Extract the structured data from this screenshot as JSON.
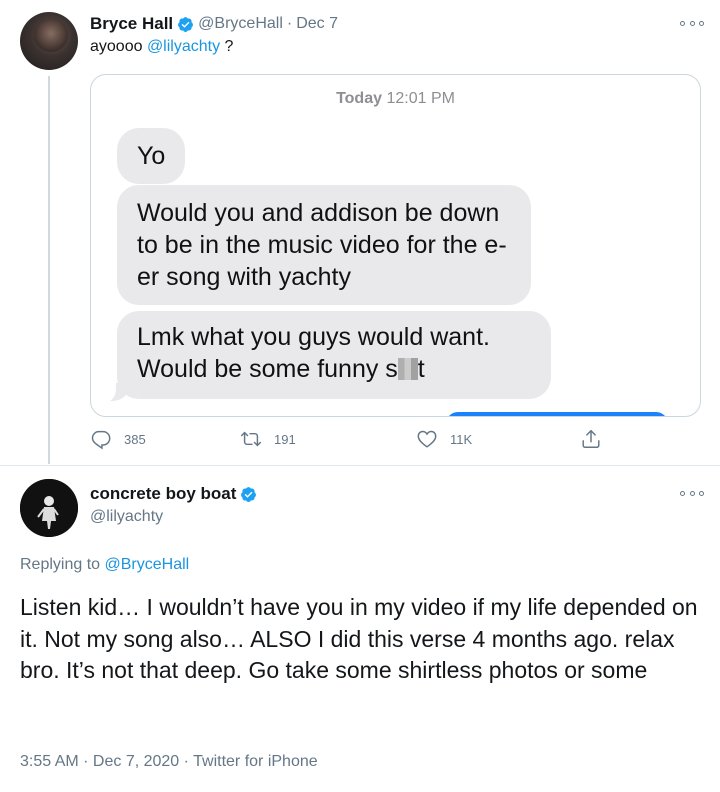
{
  "tweet": {
    "author": {
      "display_name": "Bryce Hall",
      "handle": "@BryceHall",
      "date_sep": "·",
      "date": "Dec 7"
    },
    "text_prefix": "ayoooo ",
    "mention": "@lilyachty",
    "text_suffix": " ?",
    "screenshot": {
      "time_day": "Today",
      "time_clock": "12:01 PM",
      "messages": [
        "Yo",
        "Would you and addison be down to be in the music video for the e-er song with yachty",
        "Lmk what you guys would want. Would be some funny s",
        "t"
      ]
    },
    "actions": {
      "replies": "385",
      "retweets": "191",
      "likes": "11K"
    }
  },
  "reply": {
    "author": {
      "display_name": "concrete boy boat",
      "handle": "@lilyachty"
    },
    "replying_prefix": "Replying to ",
    "replying_to": "@BryceHall",
    "text": "Listen kid… I wouldn’t have you in my video if my life depended on it. Not my song also… ALSO I did this verse 4 months ago. relax bro. It’s not that deep. Go take some shirtless photos or some",
    "timestamp": "3:55 AM · Dec 7, 2020 · Twitter for iPhone"
  },
  "colors": {
    "accent": "#1b95e0",
    "verified": "#1da1f2",
    "secondary_text": "#657786",
    "imessage_gray": "#e9e9eb",
    "imessage_blue": "#1a82fb"
  },
  "icons": [
    "more-icon",
    "verified-badge-icon",
    "reply-icon",
    "retweet-icon",
    "like-icon",
    "share-icon"
  ]
}
